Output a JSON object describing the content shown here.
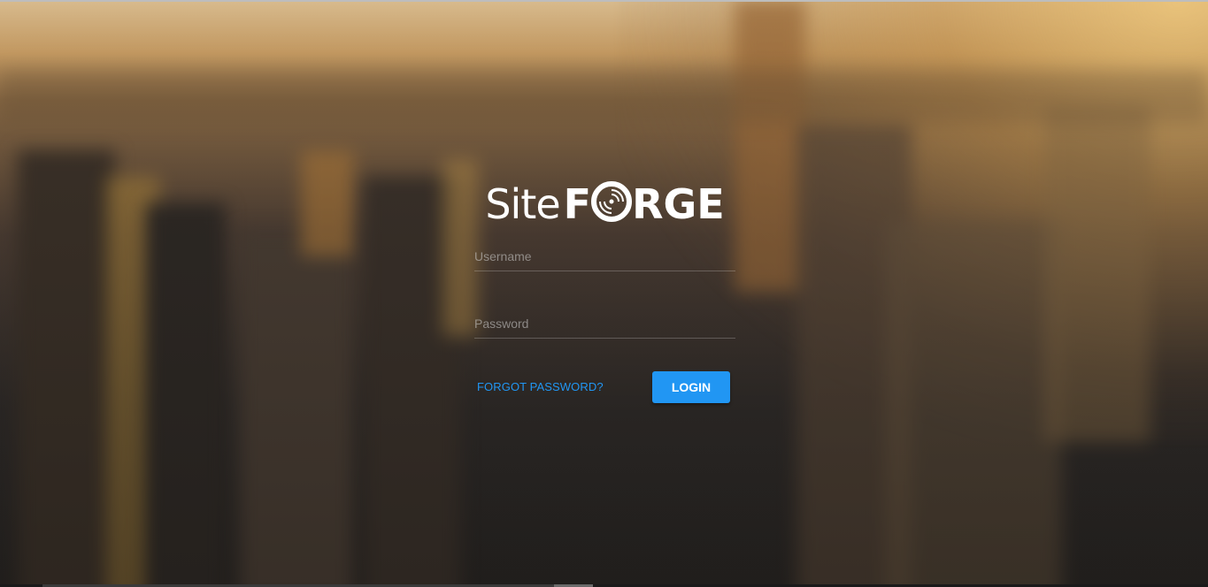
{
  "brand": {
    "name_regular": "Site",
    "name_bold": "FORGE",
    "logo_icon": "disc-logo-icon"
  },
  "form": {
    "username_placeholder": "Username",
    "password_placeholder": "Password",
    "forgot_label": "FORGOT PASSWORD?",
    "login_label": "LOGIN"
  },
  "colors": {
    "accent": "#2196f3",
    "text_on_dark": "#ffffff"
  }
}
